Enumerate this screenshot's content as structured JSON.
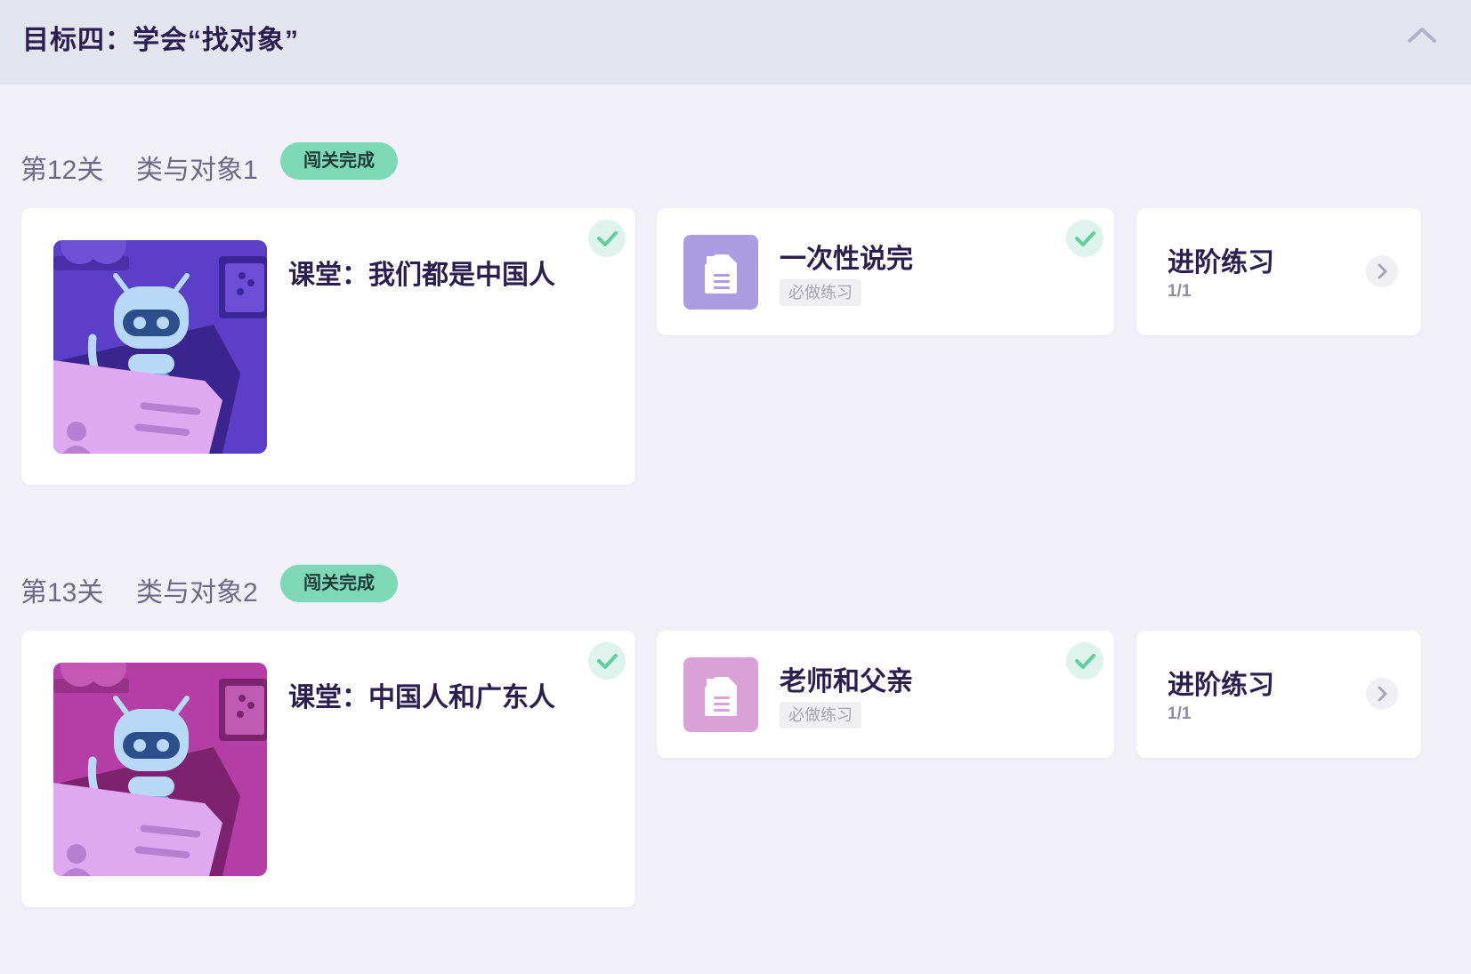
{
  "header": {
    "title": "目标四：学会“找对象”",
    "collapse_icon": "chevron-up-icon"
  },
  "levels": [
    {
      "number": "第12关",
      "name": "类与对象1",
      "badge": "闯关完成",
      "lesson": {
        "title": "课堂：我们都是中国人",
        "completed": true,
        "thumb_color": "#5b3fc8",
        "thumb_icon": "robot-reading-icon"
      },
      "exercise": {
        "title": "一次性说完",
        "tag": "必做练习",
        "completed": true,
        "tile_color": "#ac9de3",
        "icon": "document-icon"
      },
      "advanced": {
        "title": "进阶练习",
        "count": "1/1",
        "icon": "chevron-right-icon"
      }
    },
    {
      "number": "第13关",
      "name": "类与对象2",
      "badge": "闯关完成",
      "lesson": {
        "title": "课堂：中国人和广东人",
        "completed": true,
        "thumb_color": "#b53ea6",
        "thumb_icon": "robot-reading-icon"
      },
      "exercise": {
        "title": "老师和父亲",
        "tag": "必做练习",
        "completed": true,
        "tile_color": "#d9a1d6",
        "icon": "document-icon"
      },
      "advanced": {
        "title": "进阶练习",
        "count": "1/1",
        "icon": "chevron-right-icon"
      }
    }
  ],
  "colors": {
    "background": "#f1f0f7",
    "header_bg": "#e4e4ef",
    "badge_bg": "#7dd8b8",
    "check": "#5fcf9f",
    "title_text": "#2a1f4e"
  }
}
